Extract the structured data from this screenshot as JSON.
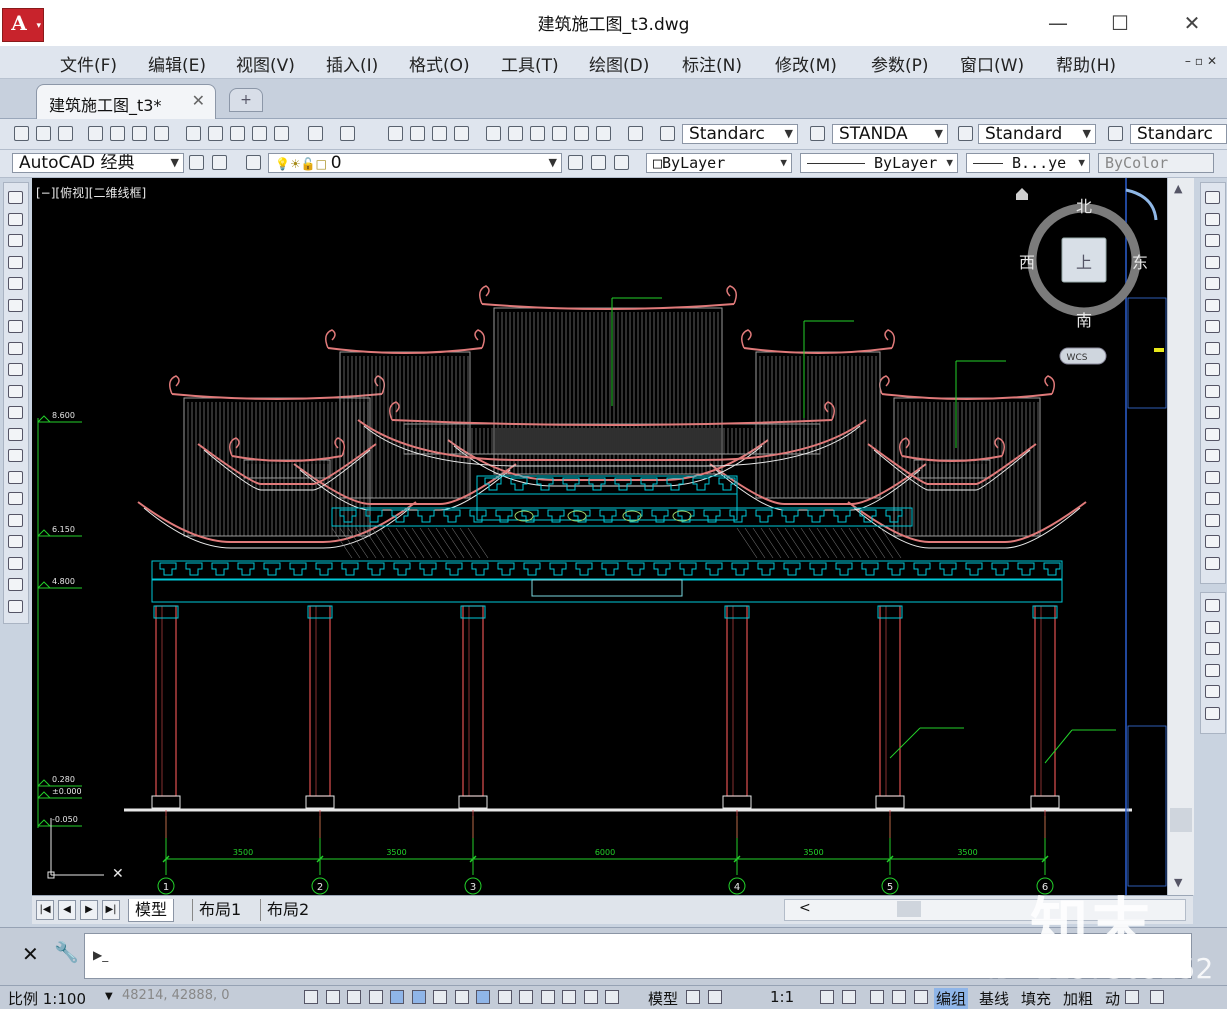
{
  "window": {
    "app_logo": "A",
    "title": "建筑施工图_t3.dwg",
    "min": "—",
    "max": "☐",
    "close": "✕"
  },
  "menu": [
    "文件(F)",
    "编辑(E)",
    "视图(V)",
    "插入(I)",
    "格式(O)",
    "工具(T)",
    "绘图(D)",
    "标注(N)",
    "修改(M)",
    "参数(P)",
    "窗口(W)",
    "帮助(H)"
  ],
  "tabs": {
    "doc_tab": "建筑施工图_t3*",
    "close_glyph": "✕",
    "new_tab_glyph": "+"
  },
  "toolbar1": {
    "text_style": "Standarc",
    "dim_style": "STANDA",
    "table_style": "Standard",
    "multileader_style": "Standarc"
  },
  "toolbar2": {
    "workspace": "AutoCAD 经典",
    "layer": "0",
    "color": "□ByLayer",
    "linetype": "ByLayer",
    "lineweight": "B...ye",
    "plotstyle": "ByColor"
  },
  "viewport": {
    "view_label": "[−][俯视][二维线框]",
    "viewcube": {
      "north": "北",
      "south": "南",
      "east": "东",
      "west": "西",
      "face": "上"
    },
    "wcs": "WCS"
  },
  "drawing": {
    "elevations": [
      "8.600",
      "6.150",
      "4.800",
      "0.280",
      "±0.000",
      "-0.050"
    ],
    "dimensions": [
      "3500",
      "3500",
      "6000",
      "3500",
      "3500"
    ],
    "axes": [
      "1",
      "2",
      "3",
      "4",
      "5",
      "6"
    ],
    "colors": {
      "roof": "#e07a7a",
      "bracket": "#00c8d8",
      "dim": "#23d02a",
      "column": "#e05050",
      "white": "#e8e8e8",
      "grey": "#9a9a9a"
    }
  },
  "layout_tabs": [
    "模型",
    "布局1",
    "布局2"
  ],
  "command": {
    "prompt": "▶_",
    "close": "✕",
    "wrench": "🔧"
  },
  "status": {
    "scale": "比例 1:100",
    "coords": "48214, 42888, 0",
    "model": "模型",
    "annoscale": "1:1",
    "buttons": [
      "编组",
      "基线",
      "填充",
      "加粗",
      "动"
    ]
  },
  "watermark": {
    "brand": "知末",
    "id": "ID: 1197309252"
  }
}
